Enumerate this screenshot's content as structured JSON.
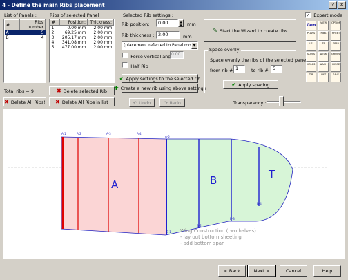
{
  "window": {
    "title": "4 - Define the main Ribs placement",
    "btn_help": "?",
    "btn_close": "✕"
  },
  "panels": {
    "label": "List of Panels :",
    "headers": [
      "#",
      "Ribs number"
    ],
    "rows": [
      [
        "A",
        "5"
      ],
      [
        "B",
        "4"
      ]
    ],
    "total": "Total ribs = 9",
    "delete_all_label": "Delete All Ribs!"
  },
  "ribs": {
    "label": "Ribs of selected Panel :",
    "headers": [
      "#",
      "Position:",
      "Thickness:"
    ],
    "rows": [
      [
        "1",
        "0.00 mm",
        "2.00 mm"
      ],
      [
        "2",
        "69.25 mm",
        "2.00 mm"
      ],
      [
        "3",
        "205.17 mm",
        "2.00 mm"
      ],
      [
        "4",
        "341.08 mm",
        "2.00 mm"
      ],
      [
        "5",
        "477.00 mm",
        "2.00 mm"
      ]
    ],
    "delete_selected_label": "Delete selected Rib",
    "delete_all_in_list_label": "Delete All Ribs in list"
  },
  "settings": {
    "title": "Selected Rib settings :",
    "position_label": "Rib position:",
    "position_value": "0.00",
    "position_unit": "mm",
    "thickness_label": "Rib thickness :",
    "thickness_value": "2.00",
    "thickness_unit": "mm",
    "placement_option": "(placement referred to Panel root)",
    "force_angle_label": "Force vertical angle =",
    "force_angle_value": "0.00",
    "half_rib_label": "Half Rib",
    "apply_label": "Apply settings to the selected rib",
    "create_label": "Create a new rib using above settings"
  },
  "wizard": {
    "label": "Start the Wizard to create ribs"
  },
  "space": {
    "title": "Space evenly",
    "desc": "Space evenly the ribs of the selected panel",
    "from_label": "from rib #",
    "from_value": "1",
    "to_label": "to rib #",
    "to_value": "5",
    "apply_label": "Apply spacing"
  },
  "toolbar": {
    "undo": "Undo",
    "redo": "Redo",
    "transparency": "Transparency :"
  },
  "expert": {
    "label": "Expert mode",
    "checked": "✓"
  },
  "drawing": {
    "panel_a": "A",
    "panel_b": "B",
    "panel_t": "T",
    "top_labels": [
      "A-1",
      "A-2",
      "A-3",
      "A-4",
      "A-5"
    ],
    "bottom_labels": [
      "B-1",
      "B-2",
      "B-3",
      "B-4"
    ],
    "note_line1": "Wing Construction (two halves)",
    "note_line2": "- lay out bottom sheeting",
    "note_line3": "- add bottom spar"
  },
  "tools": [
    [
      "Gen",
      "VIEW",
      "OPTIONS"
    ],
    [
      "PLANS",
      "RIBS",
      "SHEET"
    ],
    [
      "LE",
      "TE",
      "SPAR"
    ],
    [
      "SLOTS",
      "DECK",
      "GROOVE"
    ],
    [
      "HOLES",
      "WASH",
      "HINGE"
    ],
    [
      "TIP",
      "LIST",
      "SAVE"
    ]
  ],
  "footer": {
    "back": "< Back",
    "next": "Next >",
    "cancel": "Cancel",
    "help": "Help"
  },
  "colors": {
    "panel_a_fill": "#fbd5d5",
    "panel_b_fill": "#d7f5d7",
    "panel_a_rib": "#e00000",
    "panel_b_rib": "#2020d0",
    "outline": "#2020c0"
  }
}
